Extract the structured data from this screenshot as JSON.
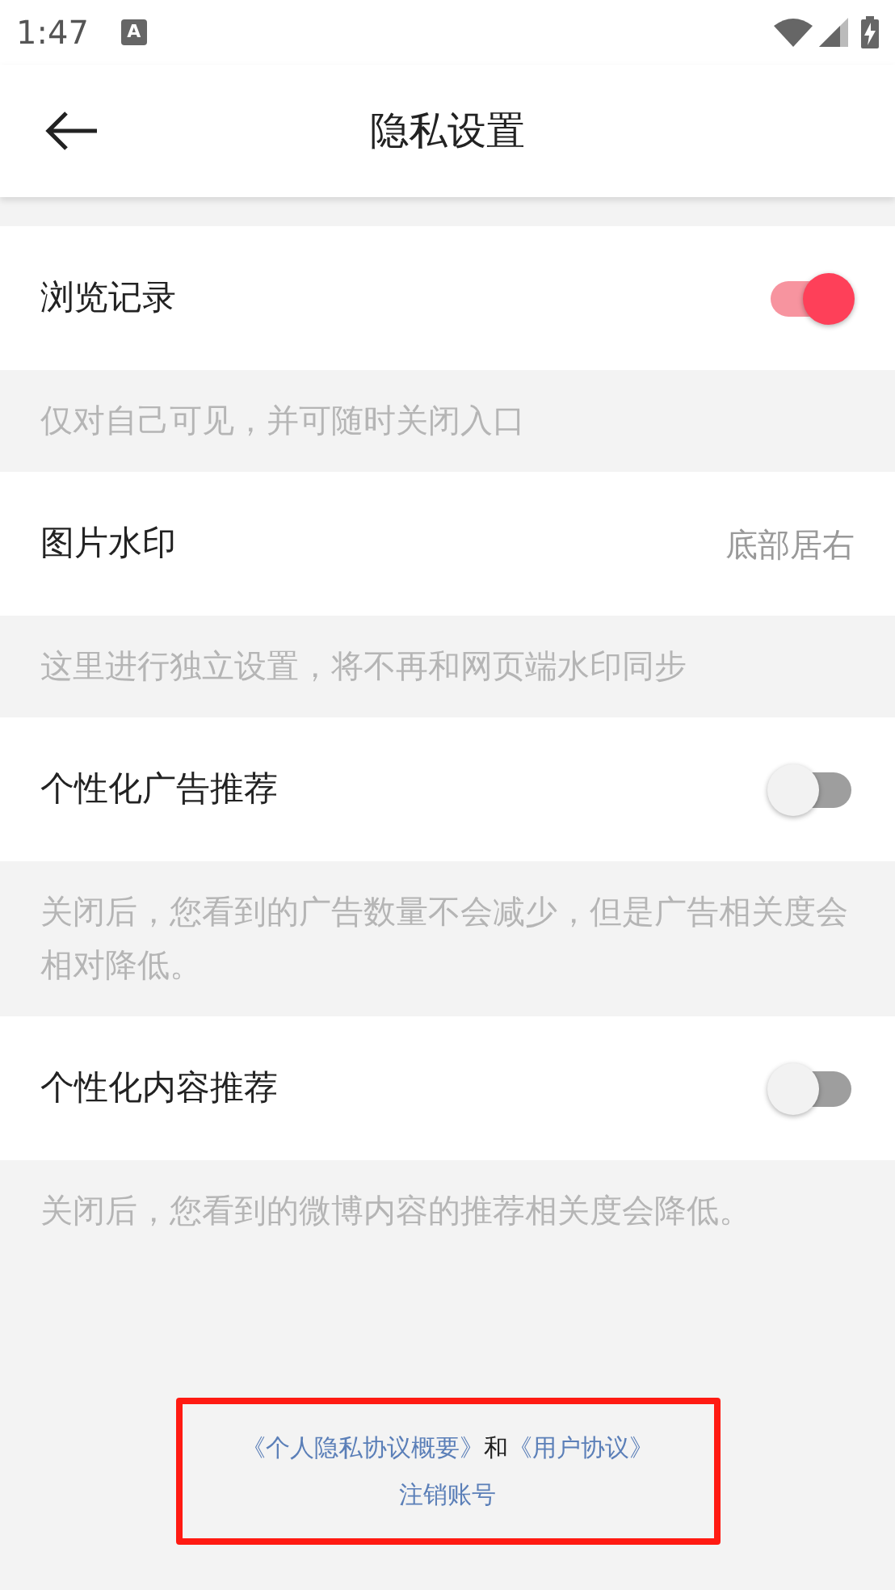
{
  "status_bar": {
    "time": "1:47",
    "notification_glyph": "A"
  },
  "toolbar": {
    "title": "隐私设置"
  },
  "settings": [
    {
      "kind": "toggle",
      "label": "浏览记录",
      "on": true,
      "note": "仅对自己可见，并可随时关闭入口"
    },
    {
      "kind": "value",
      "label": "图片水印",
      "value": "底部居右",
      "note": "这里进行独立设置，将不再和网页端水印同步"
    },
    {
      "kind": "toggle",
      "label": "个性化广告推荐",
      "on": false,
      "note": "关闭后，您看到的广告数量不会减少，但是广告相关度会相对降低。"
    },
    {
      "kind": "toggle",
      "label": "个性化内容推荐",
      "on": false,
      "note": "关闭后，您看到的微博内容的推荐相关度会降低。"
    }
  ],
  "footer": {
    "privacy_link": "《个人隐私协议概要》",
    "conjunction": "和",
    "agreement_link": "《用户协议》",
    "cancel_account_link": "注销账号"
  }
}
